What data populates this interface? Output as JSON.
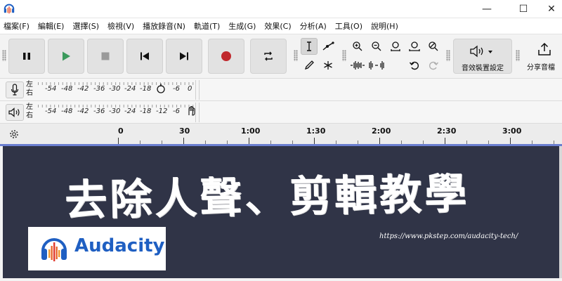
{
  "window": {
    "minimize_glyph": "—",
    "maximize_glyph": "☐",
    "close_glyph": "✕"
  },
  "menu": [
    "檔案(F)",
    "編輯(E)",
    "選擇(S)",
    "檢視(V)",
    "播放錄音(N)",
    "軌道(T)",
    "生成(G)",
    "效果(C)",
    "分析(A)",
    "工具(O)",
    "說明(H)"
  ],
  "toolbar": {
    "effects_label": "音效裝置設定",
    "share_label": "分享音檔"
  },
  "meters": {
    "record": {
      "channel_l": "左",
      "channel_r": "右",
      "scale": [
        "-54",
        "-48",
        "-42",
        "-36",
        "-30",
        "-24",
        "-18",
        "",
        "-6",
        "0"
      ]
    },
    "playback": {
      "channel_l": "左",
      "channel_r": "右",
      "scale": [
        "-54",
        "-48",
        "-42",
        "-36",
        "-30",
        "-24",
        "-18",
        "-12",
        "-6",
        ""
      ]
    }
  },
  "ruler": {
    "labels": [
      "0",
      "30",
      "1:00",
      "1:30",
      "2:00",
      "2:30",
      "3:00"
    ]
  },
  "banner": {
    "headline": "去除人聲、剪輯教學",
    "url": "https://www.pkstep.com/audacity-tech/",
    "logo_text": "Audacity"
  },
  "colors": {
    "banner_bg": "#303447",
    "logo_blue": "#1f5fc2",
    "record_red": "#c0282d",
    "play_green": "#3b9a5c",
    "playhead_line": "#6b7fd0"
  },
  "icons": [
    "audacity-logo-icon",
    "pause-icon",
    "play-icon",
    "stop-icon",
    "skip-to-start-icon",
    "skip-to-end-icon",
    "record-icon",
    "loop-icon",
    "selection-tool-icon",
    "envelope-tool-icon",
    "draw-tool-icon",
    "multi-tool-icon",
    "zoom-in-icon",
    "zoom-out-icon",
    "fit-selection-icon",
    "fit-project-icon",
    "zoom-toggle-icon",
    "trim-icon",
    "silence-icon",
    "undo-icon",
    "redo-icon",
    "speaker-icon",
    "share-icon",
    "microphone-icon",
    "gear-icon"
  ]
}
